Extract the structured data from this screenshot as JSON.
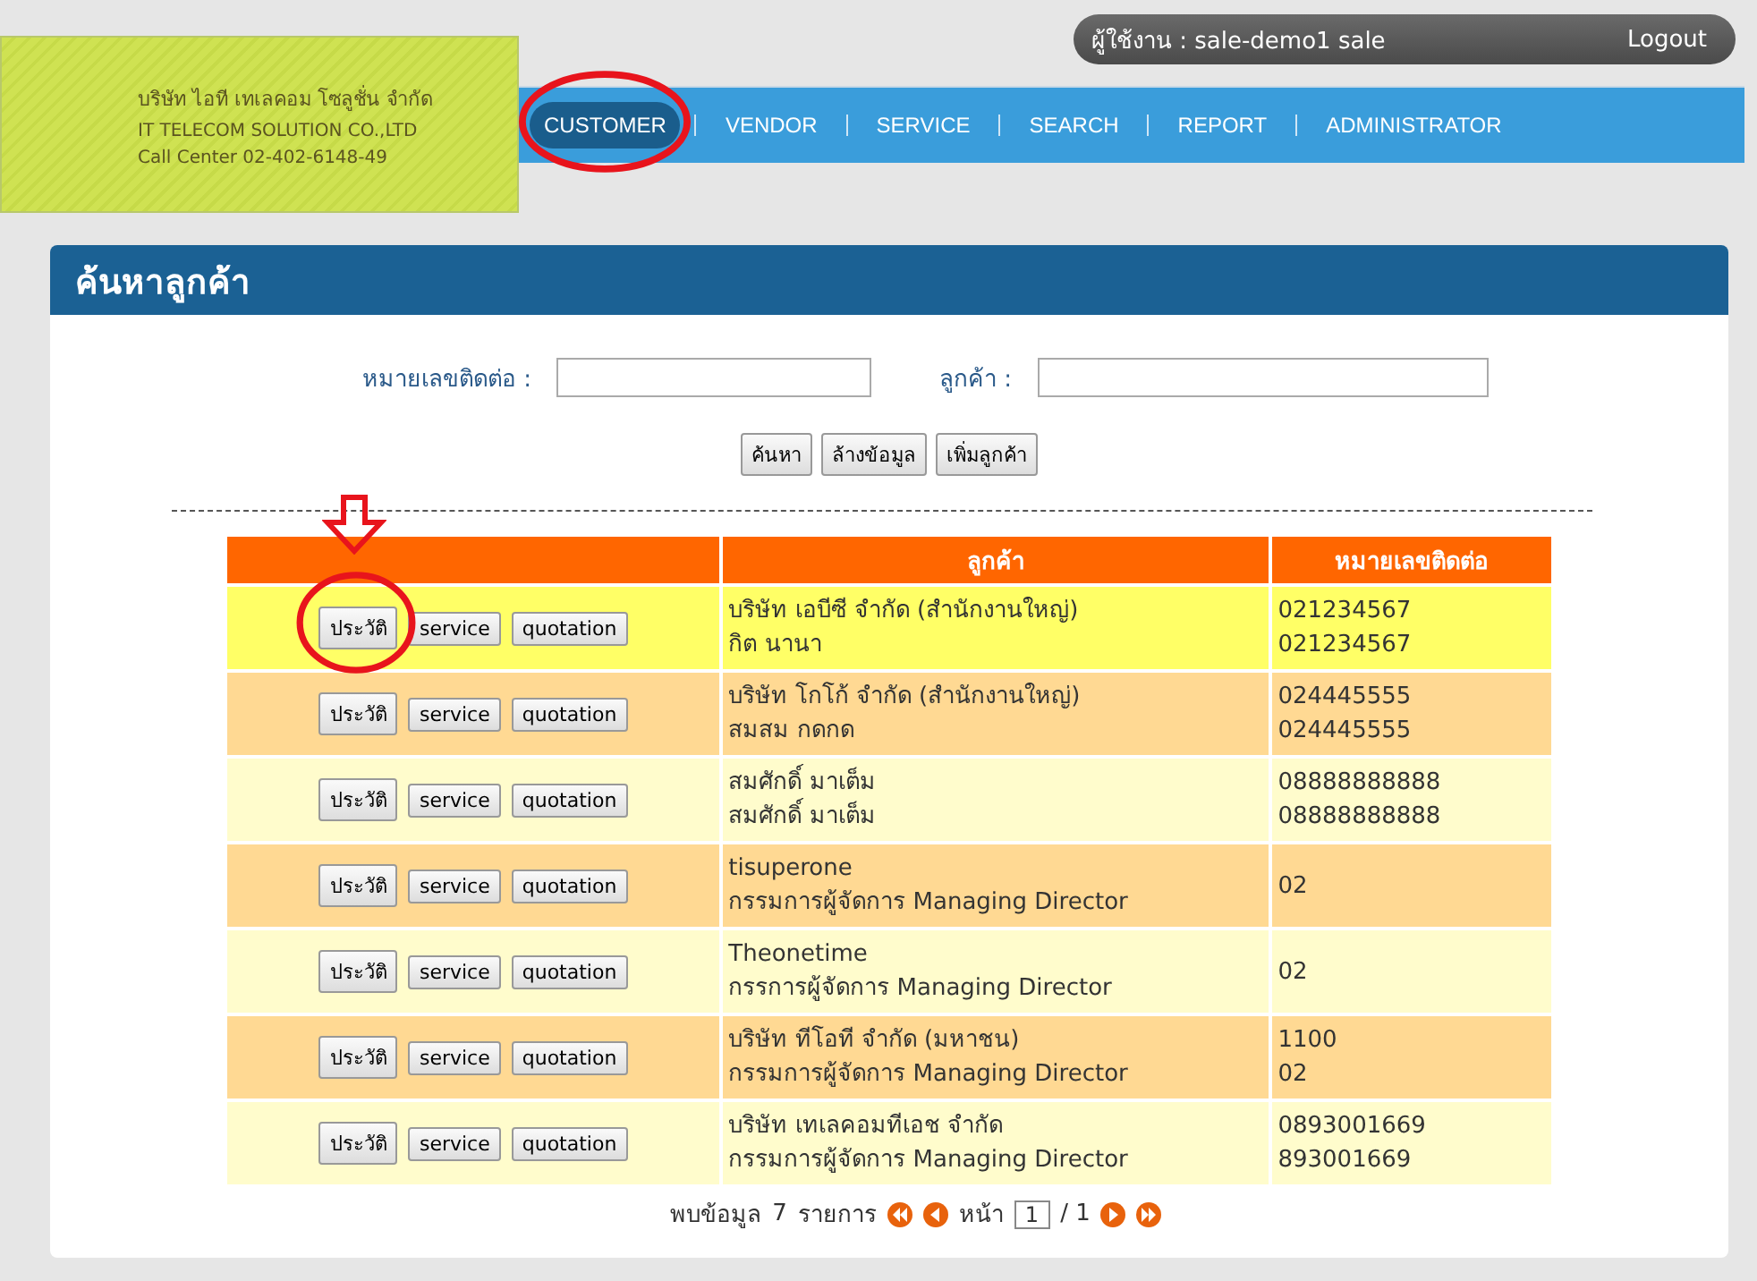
{
  "user_bar": {
    "user": "ผู้ใช้งาน : sale-demo1 sale",
    "logout": "Logout"
  },
  "company": {
    "name_th": "บริษัท ไอที เทเลคอม โซลูชั่น จำกัด",
    "name_en": "IT TELECOM SOLUTION CO.,LTD",
    "call_center": "Call Center 02-402-6148-49"
  },
  "nav": [
    {
      "label": "CUSTOMER",
      "selected": true
    },
    {
      "label": "VENDOR",
      "selected": false
    },
    {
      "label": "SERVICE",
      "selected": false
    },
    {
      "label": "SEARCH",
      "selected": false
    },
    {
      "label": "REPORT",
      "selected": false
    },
    {
      "label": "ADMINISTRATOR",
      "selected": false
    }
  ],
  "panel": {
    "title": "ค้นหาลูกค้า"
  },
  "search": {
    "fields": [
      {
        "label": "หมายเลขติดต่อ :"
      },
      {
        "label": "ลูกค้า :"
      }
    ],
    "buttons": [
      "ค้นหา",
      "ล้างข้อมูล",
      "เพิ่มลูกค้า"
    ]
  },
  "table": {
    "columns": [
      "ลูกค้า",
      "หมายเลขติดต่อ"
    ],
    "rows": [
      {
        "selected": true,
        "actions": [
          "ประวัติ",
          "service",
          "quotation"
        ],
        "customer": [
          "บริษัท เอบีซี จำกัด (สำนักงานใหญ่)",
          "กิต นานา"
        ],
        "contact": [
          "021234567",
          "021234567"
        ]
      },
      {
        "selected": false,
        "actions": [
          "ประวัติ",
          "service",
          "quotation"
        ],
        "customer": [
          "บริษัท โกโก้ จำกัด (สำนักงานใหญ่)",
          "สมสม กดกด"
        ],
        "contact": [
          "024445555",
          "024445555"
        ]
      },
      {
        "selected": false,
        "actions": [
          "ประวัติ",
          "service",
          "quotation"
        ],
        "customer": [
          "สมศักดิ์ มาเต็ม",
          "สมศักดิ์ มาเต็ม"
        ],
        "contact": [
          "08888888888",
          "08888888888"
        ]
      },
      {
        "selected": false,
        "actions": [
          "ประวัติ",
          "service",
          "quotation"
        ],
        "customer": [
          "tisuperone",
          "กรรมการผู้จัดการ Managing Director"
        ],
        "contact": [
          "02"
        ]
      },
      {
        "selected": false,
        "actions": [
          "ประวัติ",
          "service",
          "quotation"
        ],
        "customer": [
          "Theonetime",
          "กรรการผู้จัดการ Managing Director"
        ],
        "contact": [
          "02"
        ]
      },
      {
        "selected": false,
        "actions": [
          "ประวัติ",
          "service",
          "quotation"
        ],
        "customer": [
          "บริษัท ทีโอที จำกัด (มหาชน)",
          "กรรมการผู้จัดการ Managing Director"
        ],
        "contact": [
          "1100",
          "02"
        ]
      },
      {
        "selected": false,
        "actions": [
          "ประวัติ",
          "service",
          "quotation"
        ],
        "customer": [
          "บริษัท เทเลคอมทีเอช จำกัด",
          "กรรมการผู้จัดการ Managing Director"
        ],
        "contact": [
          "0893001669",
          "893001669"
        ]
      }
    ]
  },
  "pagination": {
    "found": "พบข้อมูล",
    "count": "7",
    "unit": "รายการ",
    "page_label": "หน้า",
    "page": "1",
    "total": "/ 1"
  }
}
